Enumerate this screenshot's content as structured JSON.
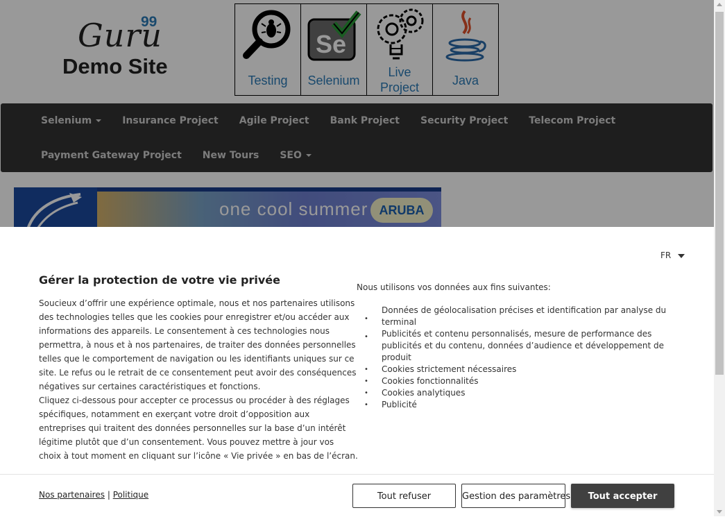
{
  "header": {
    "logo": {
      "guru": "Guru",
      "superscript": "99",
      "subtitle": "Demo Site"
    },
    "tiles": [
      {
        "label": "Testing",
        "icon": "magnifier-bug-icon"
      },
      {
        "label": "Selenium",
        "icon": "selenium-icon"
      },
      {
        "label": "Live Project",
        "icon": "lightbulb-gears-icon"
      },
      {
        "label": "Java",
        "icon": "java-icon"
      }
    ]
  },
  "nav": {
    "row1": [
      "Selenium",
      "Insurance Project",
      "Agile Project",
      "Bank Project",
      "Security Project",
      "Telecom Project"
    ],
    "row2": [
      "Payment Gateway Project",
      "New Tours",
      "SEO"
    ]
  },
  "banner": {
    "text": "one cool summer",
    "brand": "ARUBA"
  },
  "consent": {
    "language": "FR",
    "title": "Gérer la protection de votre vie privée",
    "body": [
      "Soucieux d’offrir une expérience optimale, nous et nos partenaires utilisons des technologies telles que les cookies pour enregistrer et/ou accéder aux informations des appareils. Le consentement à ces technologies nous permettra, à nous et à nos partenaires, de traiter des données personnelles telles que le comportement de navigation ou les identifiants uniques sur ce site. Le refus ou le retrait de ce consentement peut avoir des conséquences négatives sur certaines caractéristiques et fonctions.",
      "Cliquez ci-dessous pour accepter ce processus ou procéder à des réglages spécifiques, notamment en exerçant votre droit d’opposition aux entreprises qui traitent des données personnelles sur la base d’un intérêt légitime plutôt que d’un consentement. Vous pouvez mettre à jour vos choix à tout moment en cliquant sur l’icône « Vie privée » en bas de l’écran."
    ],
    "purposes_intro": "Nous utilisons vos données aux fins suivantes:",
    "purposes": [
      "Données de géolocalisation précises et identification par analyse du terminal",
      "Publicités et contenu personnalisés, mesure de performance des publicités et du contenu, données d’audience et développement de produit",
      "Cookies strictement nécessaires",
      "Cookies fonctionnalités",
      "Cookies analytiques",
      "Publicité"
    ],
    "links": {
      "partners": "Nos partenaires",
      "separator": "|",
      "policy": "Politique"
    },
    "buttons": {
      "refuse": "Tout refuser",
      "manage": "Gestion des paramètres",
      "accept": "Tout accepter"
    }
  }
}
